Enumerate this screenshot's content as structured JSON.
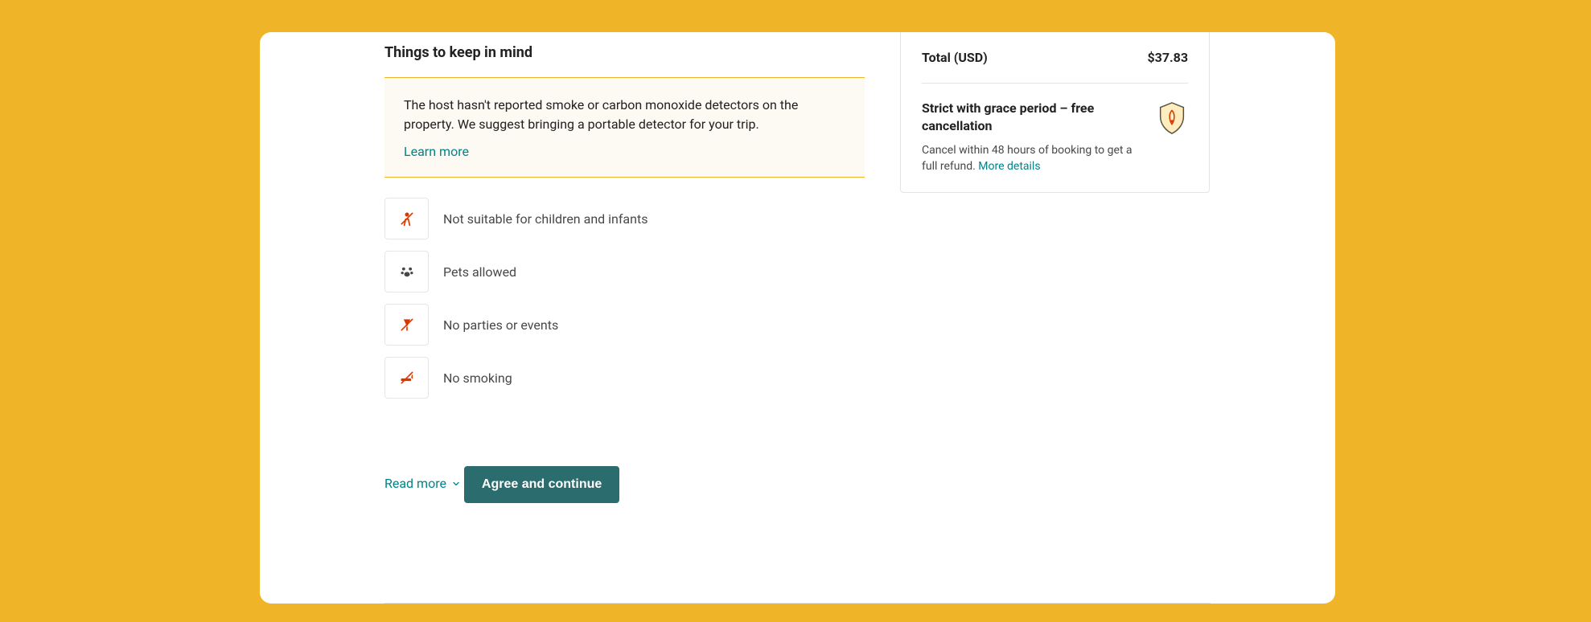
{
  "section_title": "Things to keep in mind",
  "notice": {
    "text": "The host hasn't reported smoke or carbon monoxide detectors on the property. We suggest bringing a portable detector for your trip.",
    "link_label": "Learn more"
  },
  "rules": [
    {
      "icon": "no-children-icon",
      "label": "Not suitable for children and infants"
    },
    {
      "icon": "paw-icon",
      "label": "Pets allowed"
    },
    {
      "icon": "no-party-icon",
      "label": "No parties or events"
    },
    {
      "icon": "no-smoking-icon",
      "label": "No smoking"
    }
  ],
  "read_more_label": "Read more",
  "agree_label": "Agree and continue",
  "summary": {
    "total_label": "Total (USD)",
    "total_value": "$37.83",
    "policy_title": "Strict with grace period – free cancellation",
    "policy_desc_prefix": "Cancel within 48 hours of booking to get a full refund. ",
    "policy_link_label": "More details"
  },
  "colors": {
    "accent": "#008489",
    "primary_button": "#2b6c6f",
    "page_bg": "#f0b429",
    "rule_icon_red": "#d93900"
  }
}
